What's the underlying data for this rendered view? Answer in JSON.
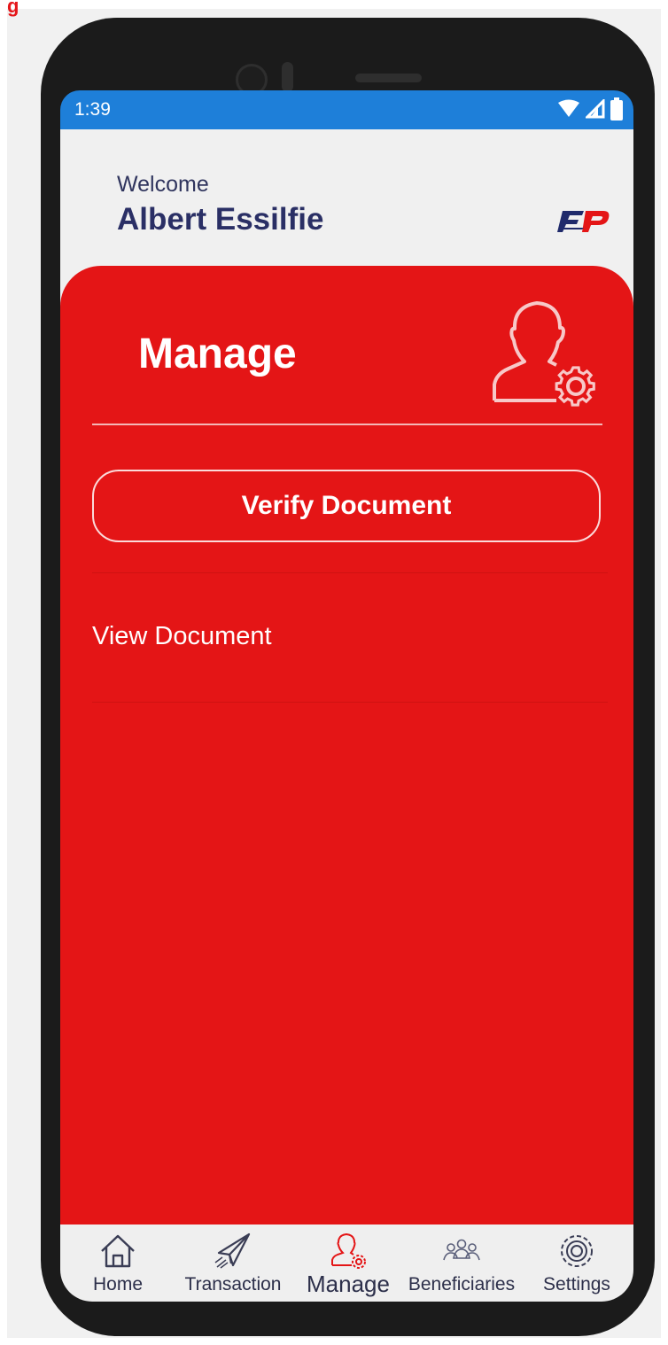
{
  "status_bar": {
    "time": "1:39"
  },
  "header": {
    "welcome": "Welcome",
    "user_name": "Albert Essilfie"
  },
  "panel": {
    "title": "Manage",
    "verify_button": "Verify Document",
    "view_link": "View Document"
  },
  "bottom_nav": {
    "items": [
      {
        "label": "Home",
        "icon": "home-icon"
      },
      {
        "label": "Transaction",
        "icon": "paper-plane-icon"
      },
      {
        "label": "Manage",
        "icon": "user-gear-icon"
      },
      {
        "label": "Beneficiaries",
        "icon": "group-icon"
      },
      {
        "label": "Settings",
        "icon": "gear-icon"
      }
    ],
    "active_index": 2
  },
  "colors": {
    "primary_red": "#e41516",
    "status_blue": "#1e7fd9",
    "navy_text": "#2a2f65"
  }
}
